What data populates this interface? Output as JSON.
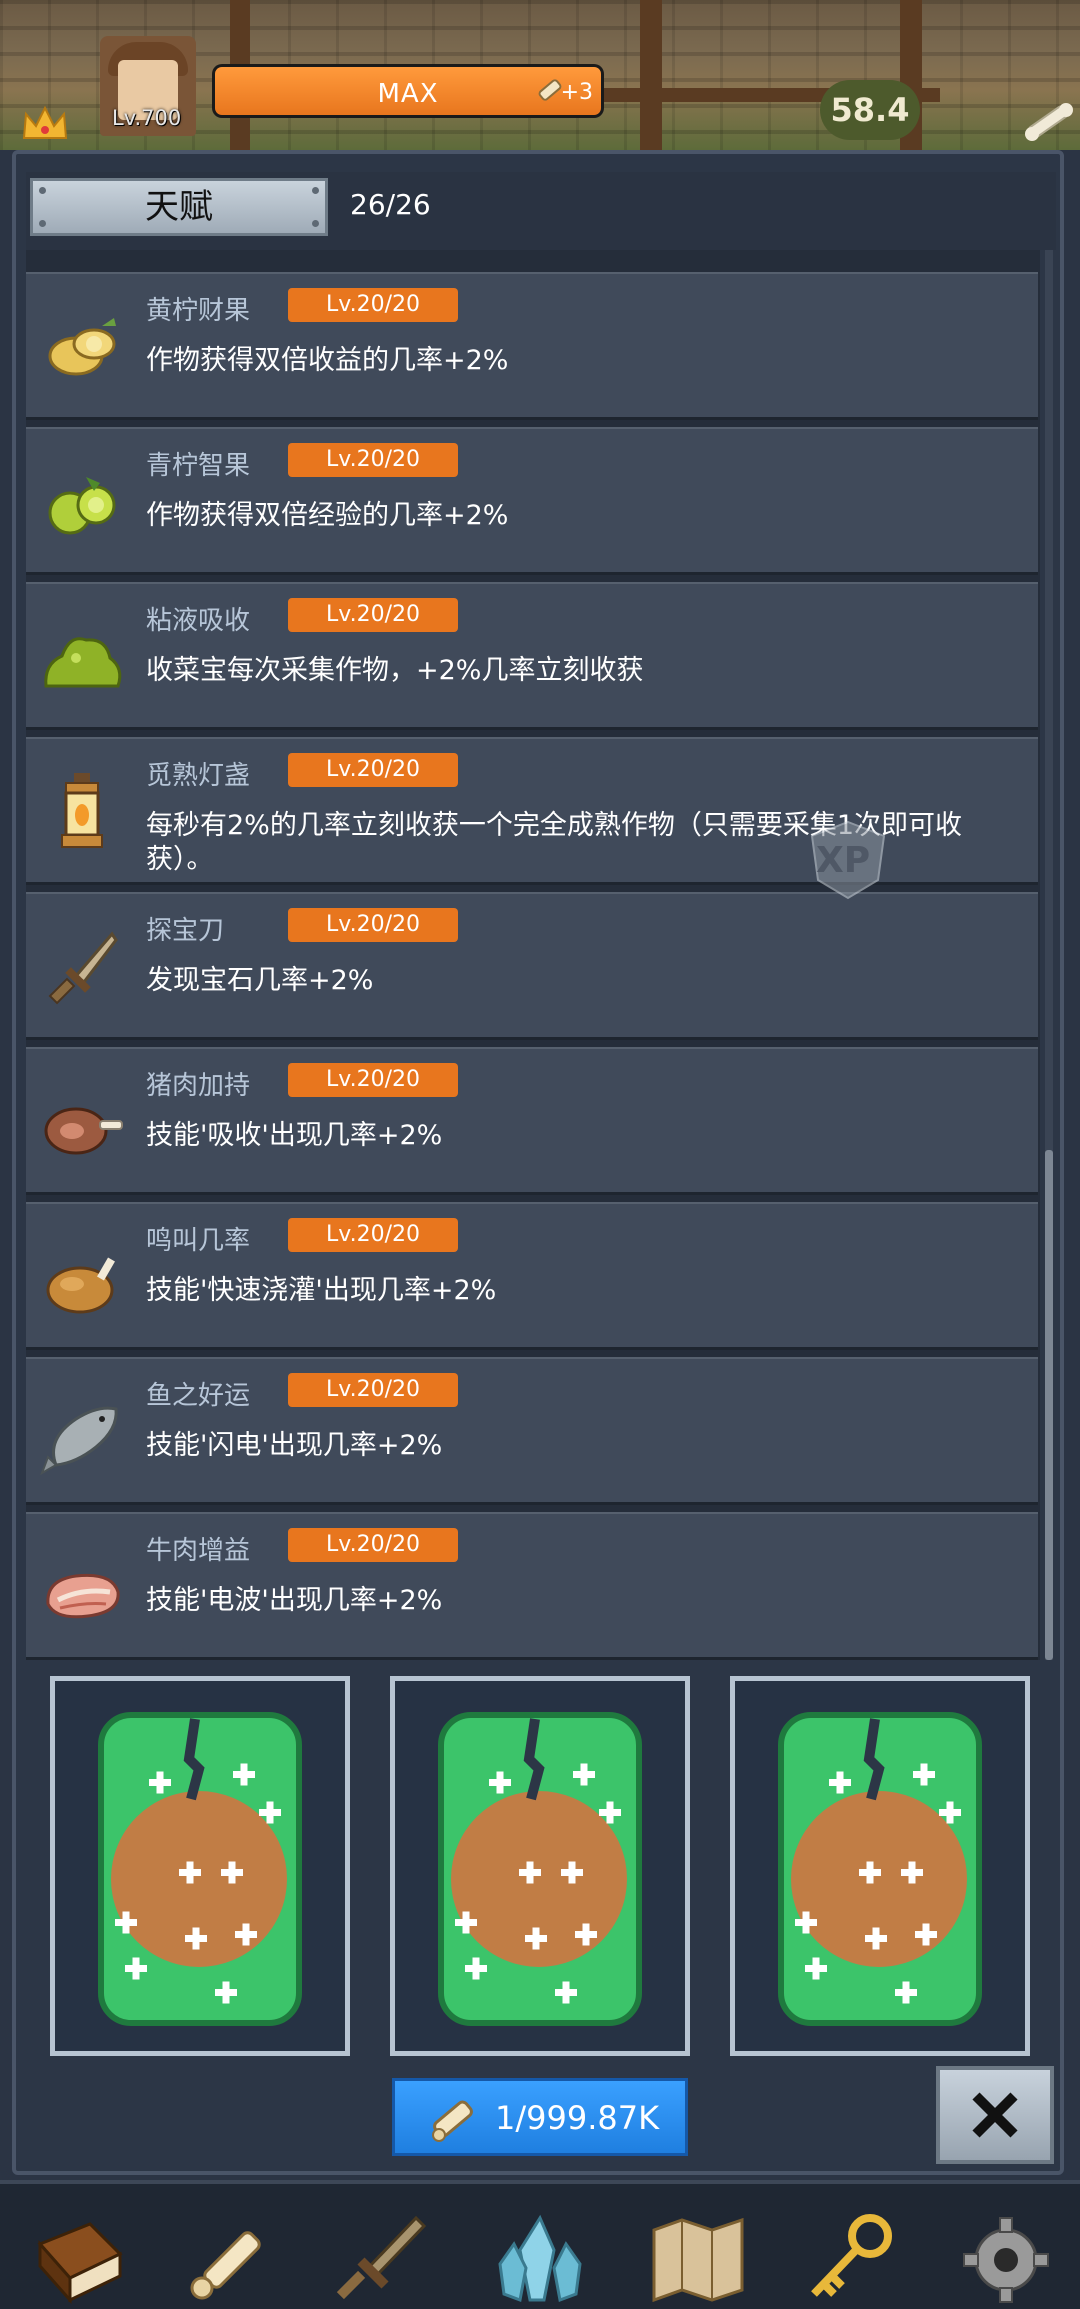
{
  "hud": {
    "level": "Lv.700",
    "progress_label": "MAX",
    "progress_fraction": 1.0,
    "bonus": "+3",
    "timer": "58.4"
  },
  "panel": {
    "tab_label": "天赋",
    "count": "26/26"
  },
  "talents": [
    {
      "name": "黄柠财果",
      "level": "Lv.20/20",
      "desc": "作物获得双倍收益的几率+2%",
      "icon": "yellow-lemon-icon"
    },
    {
      "name": "青柠智果",
      "level": "Lv.20/20",
      "desc": "作物获得双倍经验的几率+2%",
      "icon": "green-lime-icon"
    },
    {
      "name": "粘液吸收",
      "level": "Lv.20/20",
      "desc": "收菜宝每次采集作物，+2%几率立刻收获",
      "icon": "slime-icon"
    },
    {
      "name": "觅熟灯盏",
      "level": "Lv.20/20",
      "desc": "每秒有2%的几率立刻收获一个完全成熟作物（只需要采集1次即可收获）。",
      "icon": "lantern-icon"
    },
    {
      "name": "探宝刀",
      "level": "Lv.20/20",
      "desc": "发现宝石几率+2%",
      "icon": "dagger-icon"
    },
    {
      "name": "猪肉加持",
      "level": "Lv.20/20",
      "desc": "技能'吸收'出现几率+2%",
      "icon": "ham-icon"
    },
    {
      "name": "鸣叫几率",
      "level": "Lv.20/20",
      "desc": "技能'快速浇灌'出现几率+2%",
      "icon": "roast-chicken-icon"
    },
    {
      "name": "鱼之好运",
      "level": "Lv.20/20",
      "desc": "技能'闪电'出现几率+2%",
      "icon": "fish-icon"
    },
    {
      "name": "牛肉增益",
      "level": "Lv.20/20",
      "desc": "技能'电波'出现几率+2%",
      "icon": "steak-icon"
    }
  ],
  "watermark": "XP",
  "cards": [
    {
      "icon": "seed-card-icon"
    },
    {
      "icon": "seed-card-icon"
    },
    {
      "icon": "seed-card-icon"
    }
  ],
  "cost_button": {
    "label": "1/999.87K",
    "icon": "scroll-icon"
  },
  "close_button": {
    "icon": "close-icon"
  },
  "bottom_nav": [
    {
      "icon": "book-icon"
    },
    {
      "icon": "scroll-icon"
    },
    {
      "icon": "sword-icon"
    },
    {
      "icon": "crystal-icon"
    },
    {
      "icon": "map-icon"
    },
    {
      "icon": "key-icon"
    },
    {
      "icon": "gear-icon"
    }
  ],
  "colors": {
    "level_badge": "#e8761e",
    "row_bg": "#404a5a",
    "name_text": "#b7c6d8",
    "cost_button": "#2b8ff0",
    "card_green": "#3cc46a",
    "card_orange": "#c17d45"
  }
}
